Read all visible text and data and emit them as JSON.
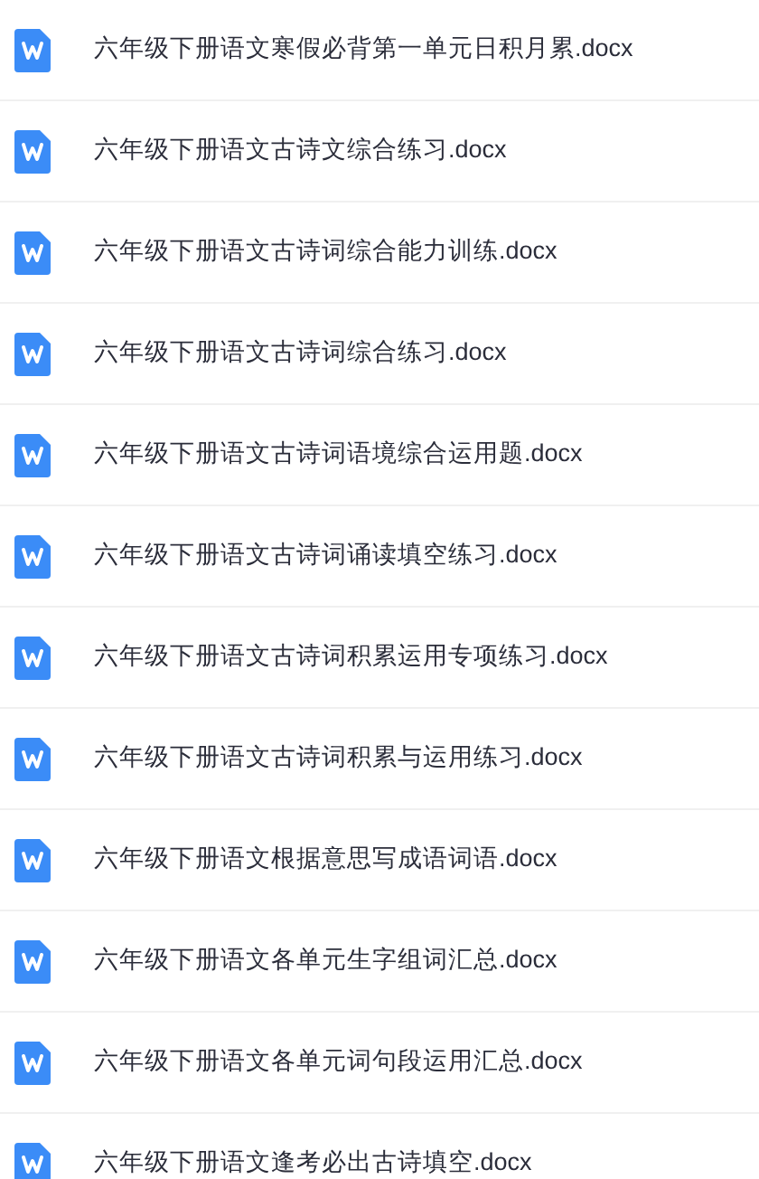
{
  "files": [
    {
      "name": "六年级下册语文寒假必背第一单元日积月累.docx"
    },
    {
      "name": "六年级下册语文古诗文综合练习.docx"
    },
    {
      "name": "六年级下册语文古诗词综合能力训练.docx"
    },
    {
      "name": "六年级下册语文古诗词综合练习.docx"
    },
    {
      "name": "六年级下册语文古诗词语境综合运用题.docx"
    },
    {
      "name": "六年级下册语文古诗词诵读填空练习.docx"
    },
    {
      "name": "六年级下册语文古诗词积累运用专项练习.docx"
    },
    {
      "name": "六年级下册语文古诗词积累与运用练习.docx"
    },
    {
      "name": "六年级下册语文根据意思写成语词语.docx"
    },
    {
      "name": "六年级下册语文各单元生字组词汇总.docx"
    },
    {
      "name": "六年级下册语文各单元词句段运用汇总.docx"
    },
    {
      "name": "六年级下册语文逢考必出古诗填空.docx"
    }
  ]
}
